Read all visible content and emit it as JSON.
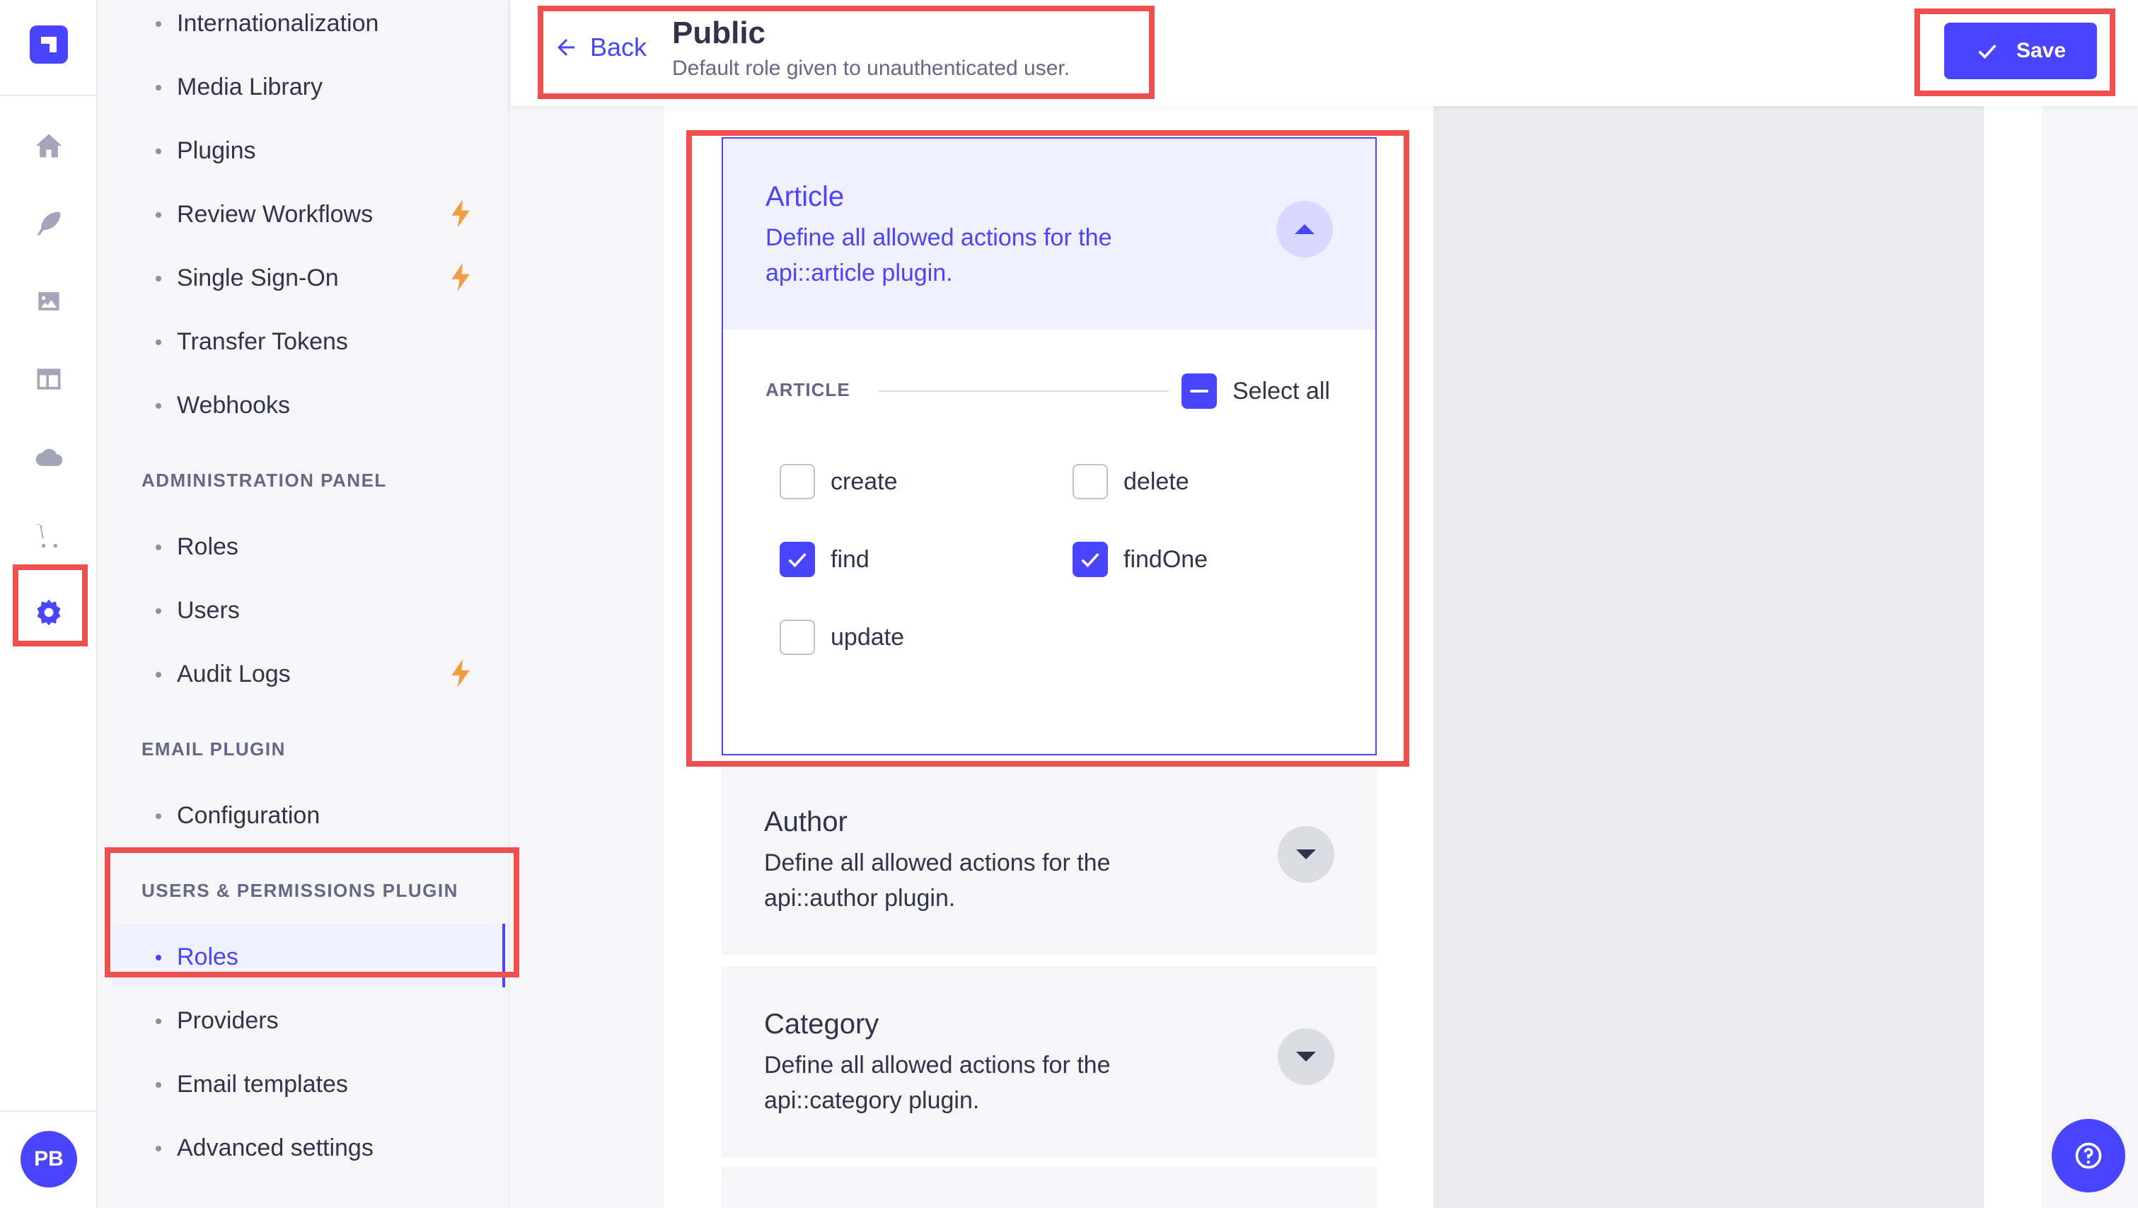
{
  "rail": {
    "avatar_initials": "PB",
    "items": [
      {
        "icon": "home-icon"
      },
      {
        "icon": "feather-icon"
      },
      {
        "icon": "image-icon"
      },
      {
        "icon": "layout-icon"
      },
      {
        "icon": "cloud-icon"
      },
      {
        "icon": "cart-icon"
      },
      {
        "icon": "settings-gear-icon",
        "active": true
      }
    ]
  },
  "subnav": {
    "items_top": [
      "Internationalization",
      "Media Library",
      "Plugins",
      "Review Workflows",
      "Single Sign-On",
      "Transfer Tokens",
      "Webhooks"
    ],
    "admin_section": "ADMINISTRATION PANEL",
    "admin_items": [
      "Roles",
      "Users",
      "Audit Logs"
    ],
    "email_section": "EMAIL PLUGIN",
    "email_items": [
      "Configuration"
    ],
    "up_section": "USERS & PERMISSIONS PLUGIN",
    "up_items": [
      "Roles",
      "Providers",
      "Email templates",
      "Advanced settings"
    ]
  },
  "header": {
    "back_label": "Back",
    "title": "Public",
    "subtitle": "Default role given to unauthenticated user.",
    "save_label": "Save"
  },
  "permissions": {
    "article": {
      "title": "Article",
      "description": "Define all allowed actions for the api::article plugin.",
      "section_label": "ARTICLE",
      "select_all_label": "Select all",
      "actions": [
        {
          "label": "create",
          "checked": false
        },
        {
          "label": "delete",
          "checked": false
        },
        {
          "label": "find",
          "checked": true
        },
        {
          "label": "findOne",
          "checked": true
        },
        {
          "label": "update",
          "checked": false
        }
      ]
    },
    "author": {
      "title": "Author",
      "description": "Define all allowed actions for the api::author plugin."
    },
    "category": {
      "title": "Category",
      "description": "Define all allowed actions for the api::category plugin."
    }
  },
  "colors": {
    "accent": "#4945ff",
    "highlight": "#ee5050",
    "bolt": "#f29d41"
  }
}
